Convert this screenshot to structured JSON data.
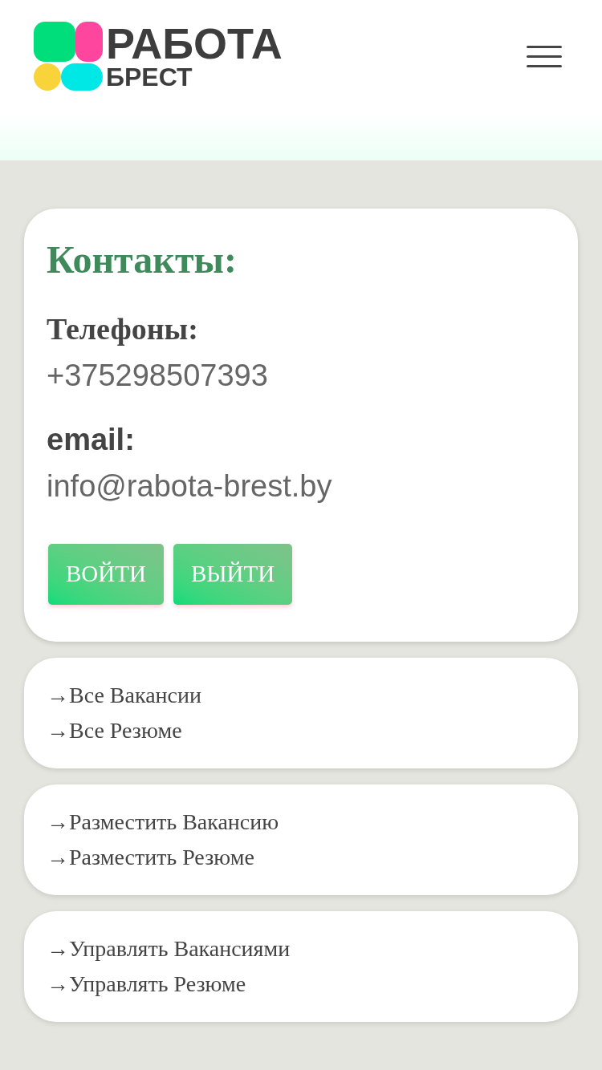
{
  "logo": {
    "line_1": "РАБОТА",
    "line_2": "БРЕСТ"
  },
  "contacts": {
    "title": "Контакты:",
    "phones_label": "Телефоны:",
    "phone": "+375298507393",
    "email_label": "email:",
    "email": "info@rabota-brest.by",
    "buttons": [
      "ВОЙТИ",
      "ВЫЙТИ"
    ]
  },
  "link_groups": [
    [
      "→Все Вакансии",
      "→Все Резюме"
    ],
    [
      "→Разместить Вакансию",
      "→Разместить Резюме"
    ],
    [
      "→Управлять Вакансиями",
      "→Управлять Резюме"
    ]
  ]
}
